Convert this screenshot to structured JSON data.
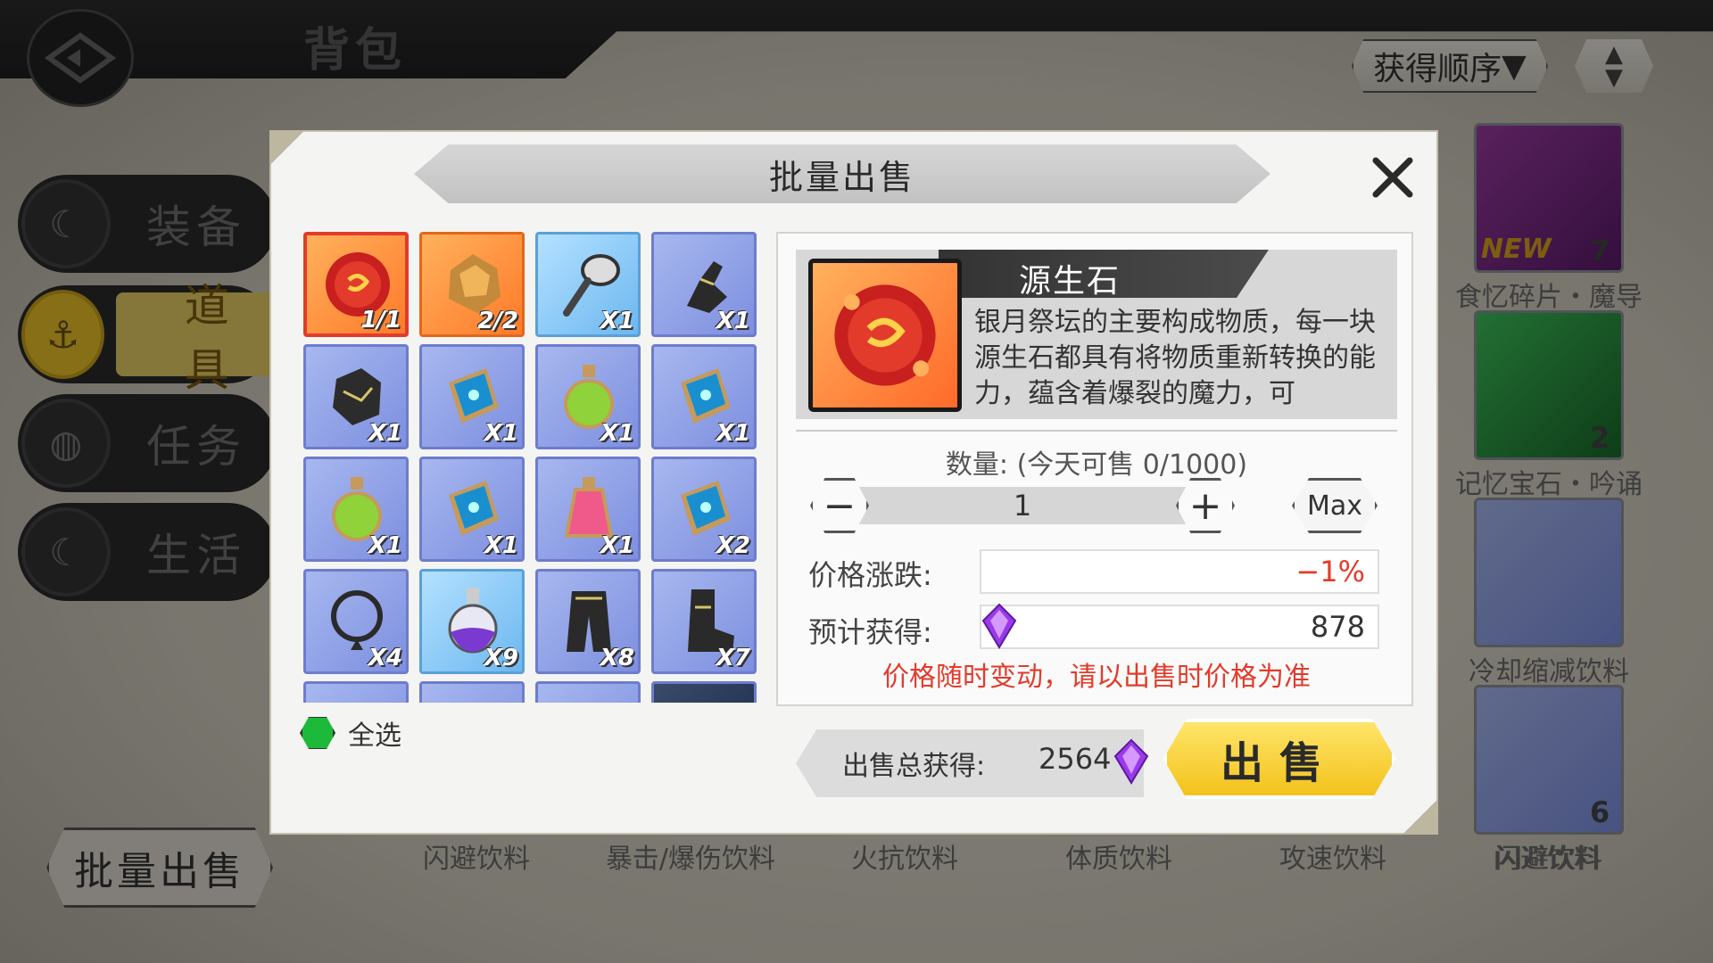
{
  "page": {
    "title": "背包",
    "sort_label": "获得顺序"
  },
  "sidebar": {
    "tabs": [
      {
        "label": "装备",
        "active": false
      },
      {
        "label": "道具",
        "active": true
      },
      {
        "label": "任务",
        "active": false
      },
      {
        "label": "生活",
        "active": false
      }
    ],
    "batch_sell": "批量出售"
  },
  "background_items": {
    "right_column": [
      {
        "name": "食忆碎片・魔导",
        "count": "7",
        "badge": "NEW"
      },
      {
        "name": "记忆宝石・吟诵",
        "count": "2"
      },
      {
        "name": "冷却缩减饮料",
        "count": ""
      },
      {
        "name": "闪避饮料",
        "count": "6"
      }
    ],
    "bottom_labels": [
      "闪避饮料",
      "暴击/爆伤饮料",
      "火抗饮料",
      "体质饮料",
      "攻速饮料",
      "闪避饮料"
    ]
  },
  "modal": {
    "title": "批量出售",
    "grid_items": [
      {
        "icon": "red-orb-icon",
        "qty": "1/1",
        "bg": "orange",
        "selected": true
      },
      {
        "icon": "ore-rock-icon",
        "qty": "2/2",
        "bg": "orange"
      },
      {
        "icon": "spoon-icon",
        "qty": "X1",
        "bg": "blue"
      },
      {
        "icon": "gauntlet-icon",
        "qty": "X1",
        "bg": "purple"
      },
      {
        "icon": "dark-rock-icon",
        "qty": "X1",
        "bg": "purple"
      },
      {
        "icon": "blue-book-icon",
        "qty": "X1",
        "bg": "purple"
      },
      {
        "icon": "green-potion-icon",
        "qty": "X1",
        "bg": "purple"
      },
      {
        "icon": "blue-book-icon",
        "qty": "X1",
        "bg": "purple"
      },
      {
        "icon": "green-potion-icon",
        "qty": "X1",
        "bg": "purple"
      },
      {
        "icon": "blue-book-icon",
        "qty": "X1",
        "bg": "purple"
      },
      {
        "icon": "pink-potion-icon",
        "qty": "X1",
        "bg": "purple"
      },
      {
        "icon": "blue-book-icon",
        "qty": "X2",
        "bg": "purple"
      },
      {
        "icon": "necklace-icon",
        "qty": "X4",
        "bg": "purple"
      },
      {
        "icon": "purple-flask-icon",
        "qty": "X9",
        "bg": "blue"
      },
      {
        "icon": "dark-pants-icon",
        "qty": "X8",
        "bg": "purple"
      },
      {
        "icon": "dark-boots-icon",
        "qty": "X7",
        "bg": "purple"
      }
    ],
    "select_all": "全选",
    "detail": {
      "name": "源生石",
      "description": "银月祭坛的主要构成物质，每一块源生石都具有将物质重新转换的能力，蕴含着爆裂的魔力，可",
      "quantity_label": "数量: (今天可售 0/1000)",
      "quantity": "1",
      "minus": "−",
      "plus": "+",
      "max": "Max",
      "price_change_label": "价格涨跌:",
      "price_change": "−1%",
      "expected_label": "预计获得:",
      "expected": "878",
      "note": "价格随时变动，请以出售时价格为准"
    },
    "total_label": "出售总获得:",
    "total_value": "2564",
    "sell_button": "出售"
  },
  "colors": {
    "accent": "#f2c21b",
    "warning": "#e23b2b",
    "select": "#1db93b"
  }
}
